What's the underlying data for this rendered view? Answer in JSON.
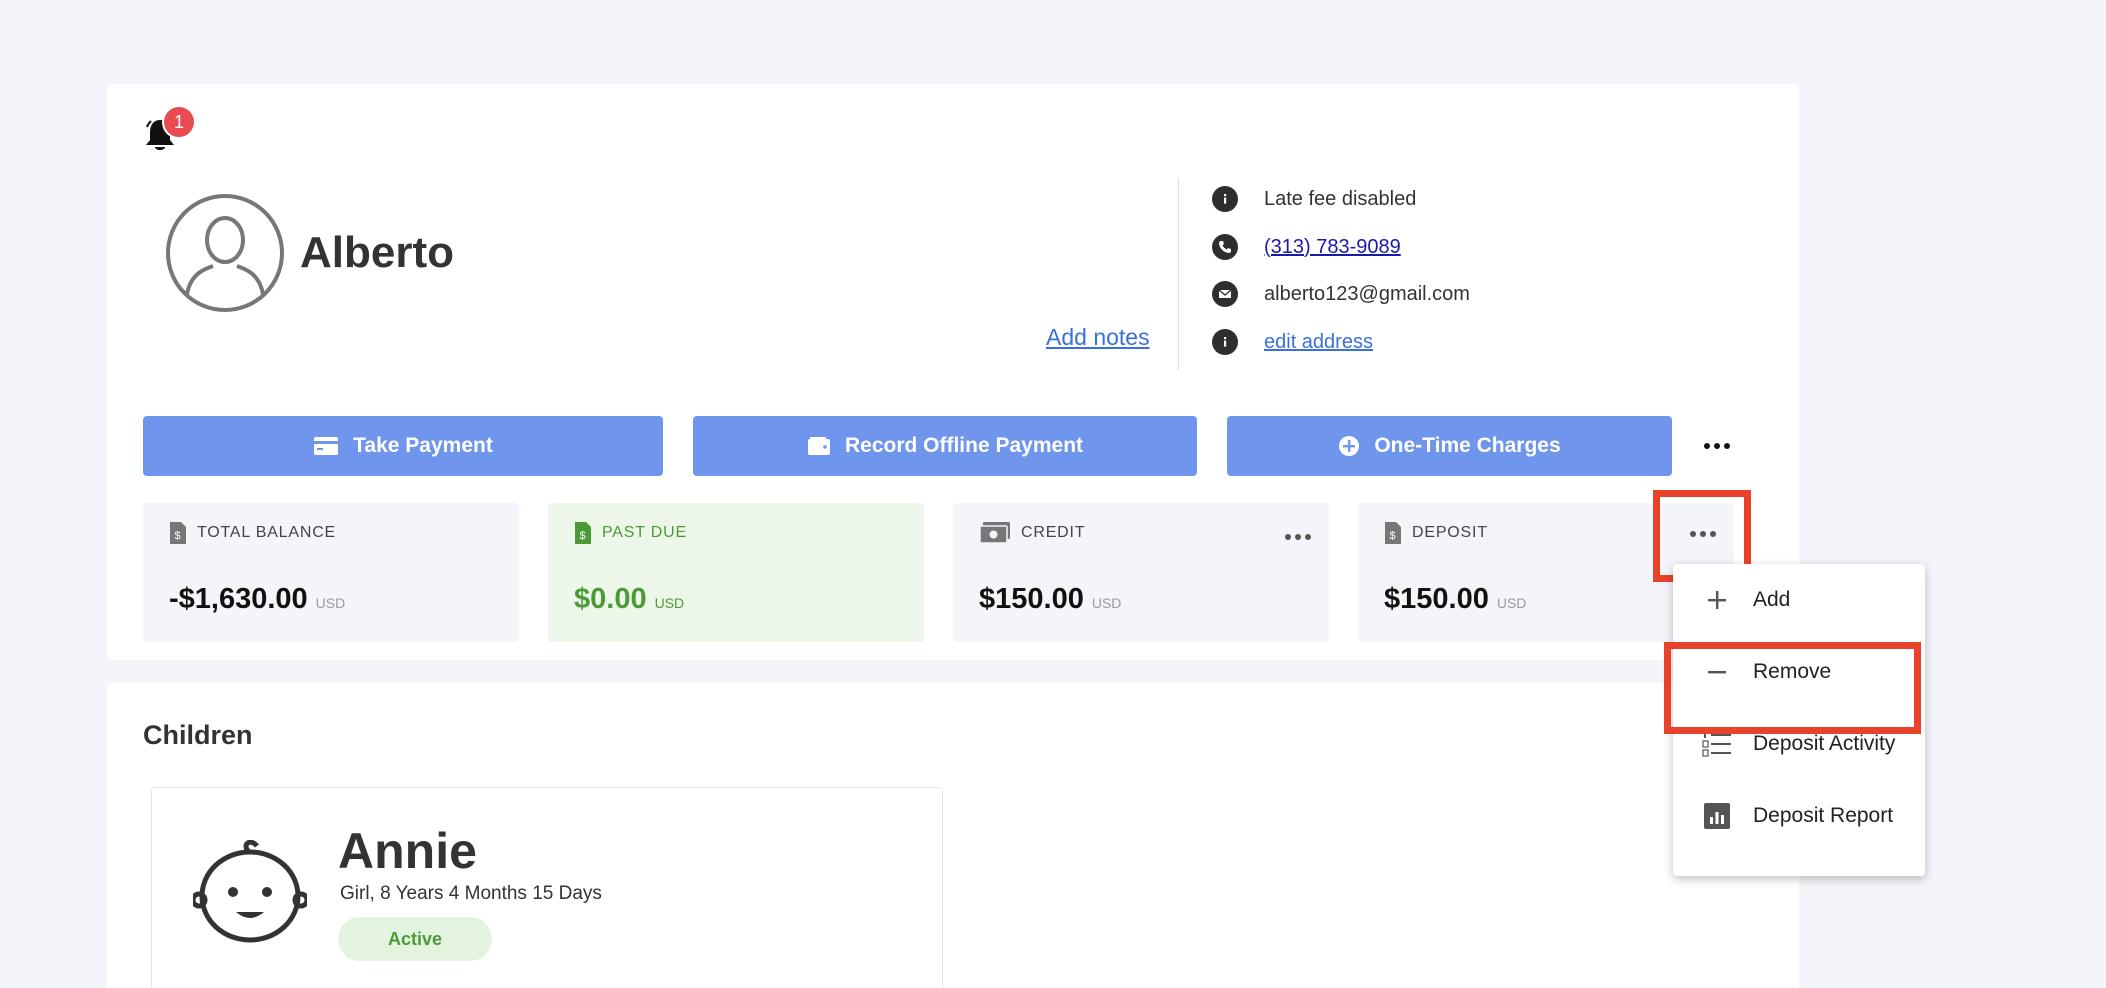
{
  "notifications": {
    "badge_count": "1"
  },
  "profile": {
    "name": "Alberto",
    "add_notes_label": "Add notes",
    "late_fee_status": "Late fee disabled",
    "phone": "(313) 783-9089",
    "email": "alberto123@gmail.com",
    "edit_address_label": "edit address"
  },
  "actions": {
    "take_payment": "Take Payment",
    "record_offline_payment": "Record Offline Payment",
    "one_time_charges": "One-Time Charges"
  },
  "balances": [
    {
      "label": "TOTAL BALANCE",
      "amount": "-$1,630.00",
      "currency": "USD"
    },
    {
      "label": "PAST DUE",
      "amount": "$0.00",
      "currency": "USD"
    },
    {
      "label": "CREDIT",
      "amount": "$150.00",
      "currency": "USD"
    },
    {
      "label": "DEPOSIT",
      "amount": "$150.00",
      "currency": "USD"
    }
  ],
  "deposit_menu": {
    "items": [
      {
        "label": "Add",
        "icon": "plus-icon"
      },
      {
        "label": "Remove",
        "icon": "minus-icon"
      },
      {
        "label": "Deposit Activity",
        "icon": "numbered-list-icon"
      },
      {
        "label": "Deposit Report",
        "icon": "bar-chart-icon"
      }
    ]
  },
  "children": {
    "title": "Children",
    "items": [
      {
        "name": "Annie",
        "details": "Girl, 8 Years 4 Months 15 Days",
        "status": "Active"
      }
    ]
  },
  "colors": {
    "primary_button": "#6f95ec",
    "success": "#4c9a37",
    "highlight": "#e8432a",
    "badge": "#e84b50",
    "link": "#3a6fdc"
  }
}
